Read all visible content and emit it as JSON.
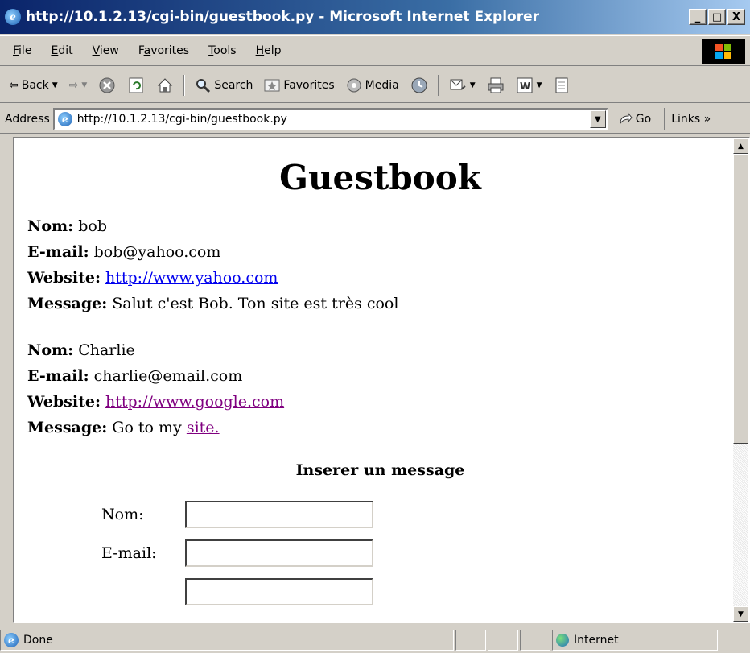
{
  "window": {
    "title": "http://10.1.2.13/cgi-bin/guestbook.py - Microsoft Internet Explorer",
    "minimize_glyph": "_",
    "maximize_glyph": "□",
    "close_glyph": "X"
  },
  "menu": {
    "items": [
      {
        "key": "F",
        "rest": "ile"
      },
      {
        "key": "E",
        "rest": "dit"
      },
      {
        "key": "V",
        "rest": "iew"
      },
      {
        "key": "a",
        "before": "F",
        "rest": "vorites"
      },
      {
        "key": "T",
        "rest": "ools"
      },
      {
        "key": "H",
        "rest": "elp"
      }
    ]
  },
  "toolbar": {
    "back_label": "Back",
    "back_icon": "⇦",
    "forward_icon": "⇨",
    "search_label": "Search",
    "favorites_label": "Favorites",
    "media_label": "Media"
  },
  "address": {
    "label": "Address",
    "url": "http://10.1.2.13/cgi-bin/guestbook.py",
    "go_label": "Go",
    "links_label": "Links »"
  },
  "page": {
    "heading": "Guestbook",
    "entries": [
      {
        "nom_label": "Nom:",
        "nom": "bob",
        "email_label": "E-mail:",
        "email": "bob@yahoo.com",
        "website_label": "Website:",
        "website": "http://www.yahoo.com",
        "message_label": "Message:",
        "message": "Salut c'est Bob. Ton site est très cool"
      },
      {
        "nom_label": "Nom:",
        "nom": "Charlie",
        "email_label": "E-mail:",
        "email": "charlie@email.com",
        "website_label": "Website:",
        "website": "http://www.google.com",
        "message_label": "Message:",
        "message": "Go to my",
        "message_link": "site."
      }
    ],
    "insert_title": "Inserer un message",
    "form": {
      "nom_label": "Nom:",
      "email_label": "E-mail:"
    }
  },
  "status": {
    "text": "Done",
    "zone": "Internet"
  },
  "colors": {
    "link": "#0000ee",
    "visited": "#800080",
    "chrome": "#d4d0c8"
  }
}
